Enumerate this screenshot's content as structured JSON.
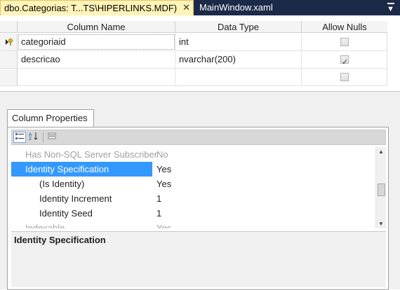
{
  "tabs": {
    "active_label": "dbo.Categorias: T...TS\\HIPERLINKS.MDF)",
    "close_glyph": "✕",
    "inactive_label": "MainWindow.xaml"
  },
  "grid": {
    "headers": [
      "Column Name",
      "Data Type",
      "Allow Nulls"
    ],
    "rows": [
      {
        "name": "categoriaid",
        "type": "int",
        "allow_nulls": false,
        "primary_key": true
      },
      {
        "name": "descricao",
        "type": "nvarchar(200)",
        "allow_nulls": true,
        "primary_key": false
      },
      {
        "name": "",
        "type": "",
        "allow_nulls": false,
        "primary_key": false
      }
    ]
  },
  "column_properties": {
    "tab_label": "Column Properties",
    "toolbar": {
      "categorized_icon": "categorized-icon",
      "alphabetical_icon": "alphabetical-icon",
      "pages_icon": "property-pages-icon"
    },
    "properties": [
      {
        "name": "Has Non-SQL Server Subscriber",
        "value": "No",
        "muted": true
      },
      {
        "name": "Identity Specification",
        "value": "Yes",
        "selected": true,
        "expander": "◢"
      },
      {
        "name": "(Is Identity)",
        "value": "Yes"
      },
      {
        "name": "Identity Increment",
        "value": "1"
      },
      {
        "name": "Identity Seed",
        "value": "1"
      },
      {
        "name": "Indexable",
        "value": "Yes",
        "muted": true
      }
    ],
    "description_title": "Identity Specification"
  },
  "colors": {
    "tabstrip": "#1b2a49",
    "active_tab": "#fff3b8",
    "selection": "#3399ff"
  }
}
